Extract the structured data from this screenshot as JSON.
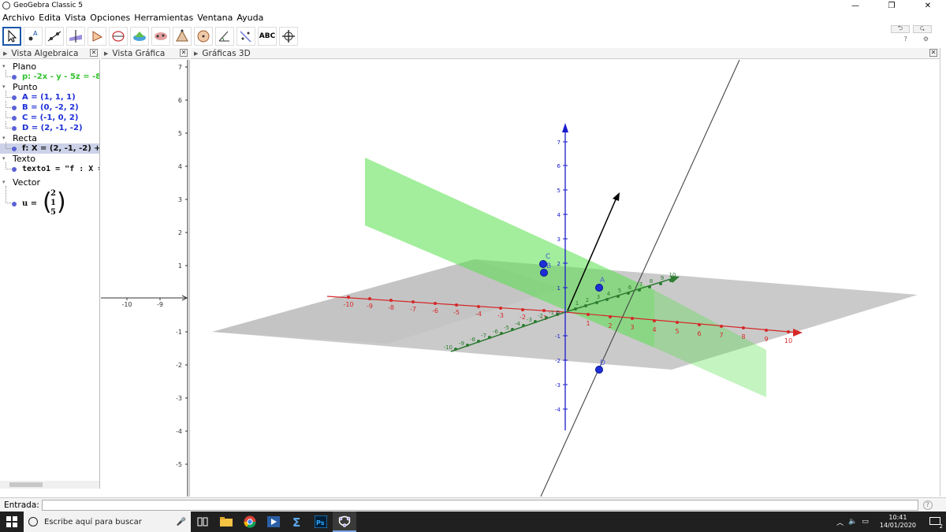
{
  "window": {
    "title": "GeoGebra Classic 5",
    "minimize": "—",
    "maximize": "❐",
    "close": "✕"
  },
  "menu": [
    "Archivo",
    "Edita",
    "Vista",
    "Opciones",
    "Herramientas",
    "Ventana",
    "Ayuda"
  ],
  "toolbar": {
    "text_tool_label": "ABC",
    "undo": "⮌",
    "redo": "⮎",
    "help_icon": "?",
    "settings_icon": "⚙"
  },
  "panels": {
    "algebra_title": "Vista Algebraica",
    "graphics_title": "Vista Gráfica",
    "g3d_title": "Gráficas 3D"
  },
  "algebra": {
    "plane_cat": "Plano",
    "plane": "p: -2x - y - 5z = -8",
    "point_cat": "Punto",
    "point_a": "A = (1, 1, 1)",
    "point_b": "B = (0, -2, 2)",
    "point_c": "C = (-1, 0, 2)",
    "point_d": "D = (2, -1, -2)",
    "line_cat": "Recta",
    "line_f": "f: X = (2, -1, -2) + λ (-2",
    "text_cat": "Texto",
    "text1": "texto1 = \"f : X =",
    "vector_cat": "Vector",
    "vector_u_name": "u =",
    "vector_u": [
      "2",
      "1",
      "5"
    ]
  },
  "graphics2d": {
    "y_ticks": [
      "7",
      "6",
      "5",
      "4",
      "3",
      "2",
      "1",
      "-1",
      "-2",
      "-3",
      "-4",
      "-5"
    ],
    "x_ticks": [
      "-10",
      "-9"
    ]
  },
  "g3d": {
    "x_ticks_neg": [
      "-10",
      "-9",
      "-8",
      "-7",
      "-6",
      "-5",
      "-4",
      "-3",
      "-2",
      "-1"
    ],
    "x_ticks_pos": [
      "1",
      "2",
      "3",
      "4",
      "5",
      "6",
      "7",
      "8",
      "9",
      "10"
    ],
    "z_ticks_pos": [
      "1",
      "2",
      "3",
      "4",
      "5",
      "6",
      "7"
    ],
    "z_ticks_neg": [
      "-1",
      "-2",
      "-3",
      "-4"
    ],
    "y_ticks_pos": [
      "1",
      "2",
      "3",
      "4",
      "5",
      "6",
      "7",
      "8",
      "9",
      "10"
    ],
    "y_ticks_neg": [
      "-10",
      "-9",
      "-8",
      "-7",
      "-6",
      "-5",
      "-4",
      "-3",
      "-2",
      "-1"
    ],
    "label_a": "A",
    "label_b": "B",
    "label_c": "C",
    "label_d": "D",
    "origin": "0",
    "colors": {
      "x_axis": "#d62828",
      "y_axis": "#2e7d32",
      "z_axis": "#1a1acc",
      "plane": "#55e04a",
      "point": "#1c2fd6"
    }
  },
  "input": {
    "label": "Entrada:",
    "value": "",
    "help": "?"
  },
  "taskbar": {
    "search_placeholder": "Escribe aquí para buscar",
    "time": "10:41",
    "date": "14/01/2020",
    "notif_count": "2"
  }
}
